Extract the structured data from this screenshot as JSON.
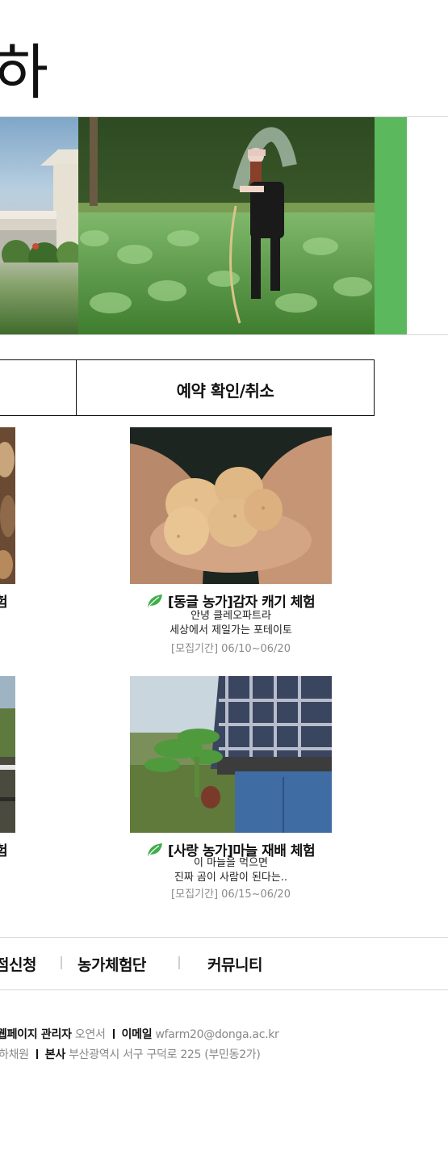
{
  "header": {
    "title_fragment": "하"
  },
  "tabs": [
    {
      "label": ""
    },
    {
      "label": "예약 확인/취소"
    }
  ],
  "cards": [
    {
      "title": "[동글 농가]감자 캐기 체험",
      "desc_line1": "안녕 클레오파트라",
      "desc_line2": "세상에서 제일가는 포테이토",
      "period": "[모집기간] 06/10~06/20"
    },
    {
      "title": "[사랑 농가]마늘 재배 체험",
      "desc_line1": "이 마늘을 먹으면",
      "desc_line2": "진짜 곰이 사람이 된다는..",
      "period": "[모집기간] 06/15~06/20"
    }
  ],
  "left_cards": [
    {
      "title_fragment": "험"
    },
    {
      "title_fragment": "험"
    }
  ],
  "menu": [
    {
      "label": "점신청"
    },
    {
      "label": "농가체험단"
    },
    {
      "label": "커뮤니티"
    }
  ],
  "footer": {
    "admin_label": "웹페이지 관리자",
    "admin_name": "오연서",
    "email_label": "이메일",
    "email": "wfarm20@donga.ac.kr",
    "name2": "하채원",
    "office_label": "본사",
    "address": "부산광역시 서구 구덕로 225 (부민동2가)"
  },
  "colors": {
    "accent_green": "#5cb85c",
    "leaf_green": "#3fae49",
    "muted_text": "#888888"
  },
  "icons": {
    "leaf": "leaf-icon"
  }
}
